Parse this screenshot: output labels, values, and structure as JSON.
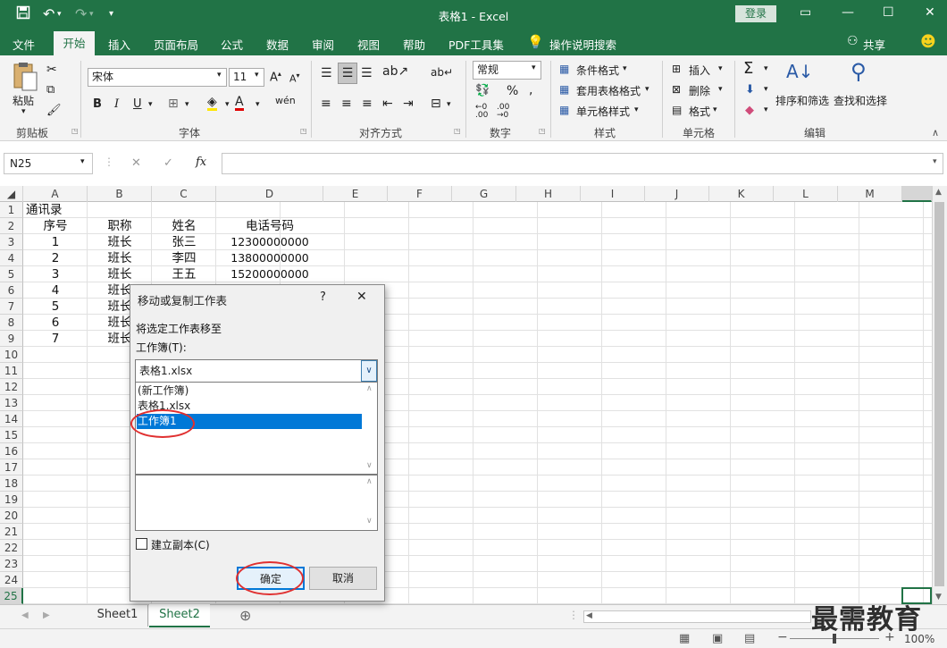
{
  "window": {
    "title": "表格1  -  Excel",
    "login": "登录"
  },
  "quick_access": {
    "save_icon": "save-icon",
    "undo_icon": "undo-icon",
    "redo_icon": "redo-icon"
  },
  "tabs": [
    "文件",
    "开始",
    "插入",
    "页面布局",
    "公式",
    "数据",
    "审阅",
    "视图",
    "帮助",
    "PDF工具集",
    "操作说明搜索"
  ],
  "share": "共享",
  "ribbon": {
    "paste": "粘贴",
    "clipboard": "剪贴板",
    "font_name": "宋体",
    "font_size": "11",
    "bold": "B",
    "italic": "I",
    "underline": "U",
    "font_group": "字体",
    "align_group": "对齐方式",
    "number_format": "常规",
    "number_group": "数字",
    "conditional": "条件格式",
    "table_style": "套用表格格式",
    "cell_style": "单元格样式",
    "style_group": "样式",
    "insert": "插入",
    "delete": "删除",
    "format": "格式",
    "cells_group": "单元格",
    "sort": "排序和筛选",
    "find": "查找和选择",
    "edit_group": "编辑"
  },
  "formula_bar": {
    "name_box": "N25",
    "fx": "fx",
    "cancel": "✕",
    "confirm": "✓"
  },
  "columns": [
    "A",
    "B",
    "C",
    "D",
    "E",
    "F",
    "G",
    "H",
    "I",
    "J",
    "K",
    "L",
    "M"
  ],
  "rows": [
    "1",
    "2",
    "3",
    "4",
    "5",
    "6",
    "7",
    "8",
    "9",
    "10",
    "11",
    "12",
    "13",
    "14",
    "15",
    "16",
    "17",
    "18",
    "19",
    "20",
    "21",
    "22",
    "23",
    "24",
    "25"
  ],
  "cells": {
    "a1": "通讯录",
    "headers": [
      "序号",
      "职称",
      "姓名",
      "电话号码"
    ],
    "data": [
      [
        "1",
        "班长",
        "张三",
        "12300000000"
      ],
      [
        "2",
        "班长",
        "李四",
        "13800000000"
      ],
      [
        "3",
        "班长",
        "王五",
        "15200000000"
      ],
      [
        "4",
        "班长"
      ],
      [
        "5",
        "班长"
      ],
      [
        "6",
        "班长"
      ],
      [
        "7",
        "班长"
      ]
    ]
  },
  "sheets": [
    "Sheet1",
    "Sheet2"
  ],
  "status": {
    "zoom": "100%"
  },
  "dialog": {
    "title": "移动或复制工作表",
    "help": "?",
    "close": "✕",
    "move_to": "将选定工作表移至",
    "workbook_label": "工作簿(T):",
    "workbook_value": "表格1.xlsx",
    "workbook_options": [
      "(新工作簿)",
      "表格1.xlsx",
      "工作簿1"
    ],
    "selected_option": "工作簿1",
    "copy_label": "建立副本(C)",
    "ok": "确定",
    "cancel": "取消"
  },
  "watermark": "最需教育",
  "colors": {
    "excel_green": "#217346",
    "selection_blue": "#0078d7",
    "annotation_red": "#e03030"
  }
}
